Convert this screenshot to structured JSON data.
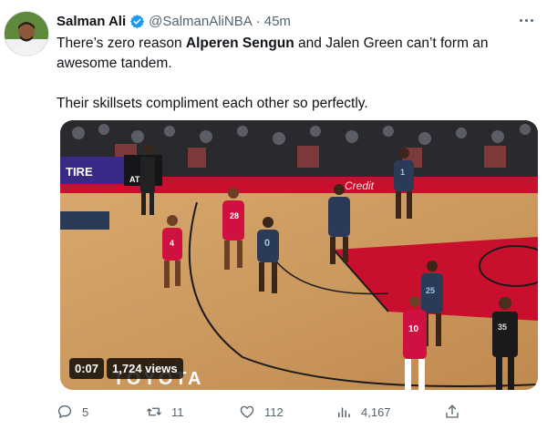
{
  "tweet": {
    "author_name": "Salman Ali",
    "handle": "@SalmanAliNBA",
    "separator": "·",
    "time": "45m",
    "text_line1_pre": "There’s zero reason ",
    "text_line1_bold": "Alperen Sengun",
    "text_line1_post": " and Jalen Green can’t form an awesome tandem.",
    "text_line2": "Their skillsets compliment each other so perfectly."
  },
  "video": {
    "timestamp": "0:07",
    "views": "1,724 views",
    "court_signage": {
      "tire": "TIRE",
      "att": "AT&T",
      "credit": "Credit",
      "toyota": "TOYOTA"
    },
    "jersey_numbers": [
      "4",
      "28",
      "0",
      "1",
      "25",
      "10",
      "35"
    ]
  },
  "actions": {
    "reply_count": "5",
    "retweet_count": "11",
    "like_count": "112",
    "views_count": "4,167"
  },
  "colors": {
    "verified": "#1d9bf0",
    "secondary_text": "#536471",
    "rockets_red": "#ce1141",
    "wolves_navy": "#2b3a57"
  }
}
